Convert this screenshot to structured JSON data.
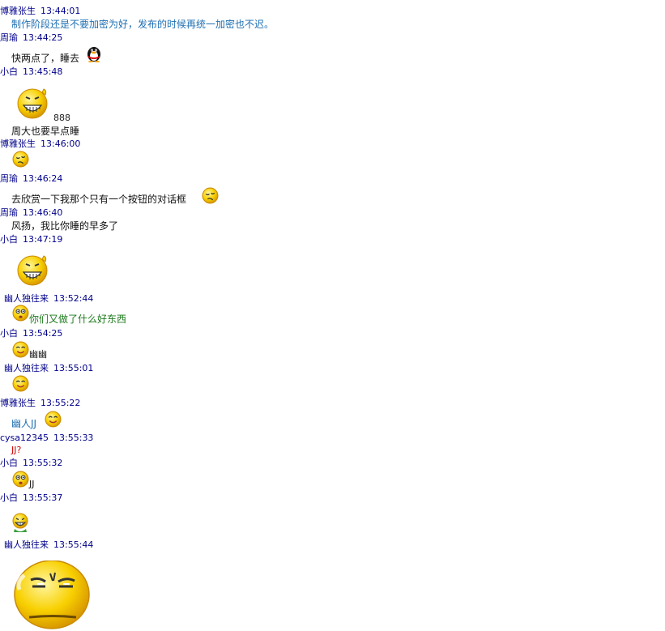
{
  "messages": [
    {
      "sender": "博雅张生",
      "time": "13:44:01",
      "text": "制作阶段还是不要加密为好，发布的时候再统一加密也不迟。"
    },
    {
      "sender": "周瑜",
      "time": "13:44:25",
      "text": "快两点了，睡去"
    },
    {
      "sender": "小白",
      "time": "13:45:48",
      "text1": "888",
      "text2": "周大也要早点睡"
    },
    {
      "sender": "博雅张生",
      "time": "13:46:00"
    },
    {
      "sender": "周瑜",
      "time": "13:46:24",
      "text": "去欣赏一下我那个只有一个按钮的对话框"
    },
    {
      "sender": "周瑜",
      "time": "13:46:40",
      "text": "风扬，我比你睡的早多了"
    },
    {
      "sender": "小白",
      "time": "13:47:19"
    },
    {
      "sender": "幽人独往来",
      "time": "13:52:44",
      "text": "你们又做了什么好东西"
    },
    {
      "sender": "小白",
      "time": "13:54:25",
      "text": "幽幽"
    },
    {
      "sender": "幽人独往来",
      "time": "13:55:01"
    },
    {
      "sender": "博雅张生",
      "time": "13:55:22",
      "text": "幽人JJ"
    },
    {
      "sender": "cysa12345",
      "time": "13:55:33",
      "text": "JJ?"
    },
    {
      "sender": "小白",
      "time": "13:55:32",
      "text": "JJ"
    },
    {
      "sender": "小白",
      "time": "13:55:37"
    },
    {
      "sender": "幽人独往来",
      "time": "13:55:44"
    }
  ],
  "icons": {
    "penguin": "penguin-icon",
    "grin": "grin-emoticon-icon",
    "sleepy": "sleepy-emoticon-icon",
    "surprised": "surprised-emoticon-icon",
    "smile": "smile-emoticon-icon",
    "laugh": "laugh-emoticon-icon",
    "sneer": "sneer-emoticon-icon"
  },
  "colors": {
    "sender": "#00008b",
    "blue_text": "#1f6fb2",
    "green_text": "#1c7a1c",
    "red_text": "#cc0000",
    "emoji": "#f6c700"
  }
}
